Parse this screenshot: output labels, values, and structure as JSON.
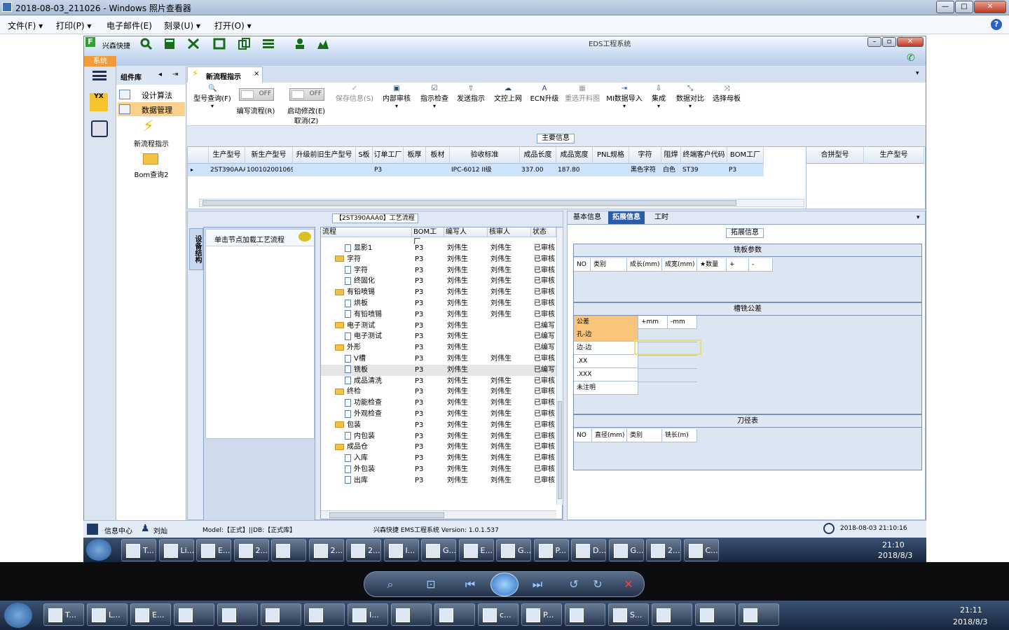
{
  "viewer": {
    "title": "2018-08-03_211026 - Windows 照片查看器",
    "menu": [
      "文件(F)",
      "打印(P)",
      "电子邮件(E)",
      "刻录(U)",
      "打开(O)"
    ]
  },
  "app": {
    "brand": "兴森快捷",
    "system_title": "EDS工程系统",
    "sys_tab": "系统",
    "component_lib": "组件库",
    "components": [
      "设计算法",
      "数据管理",
      "新流程指示",
      "Bom查询2"
    ],
    "doc_tab": "新流程指示",
    "toolbar": {
      "query": "型号查询(F)",
      "toggle1_state": "OFF",
      "toggle1": "编写流程(R)",
      "toggle2_state": "OFF",
      "toggle2": "启动修改(E)",
      "cancel": "取消(Z)",
      "save": "保存信息(S)",
      "internal_review": "内部审核",
      "instruct_check": "指示检查",
      "publish": "发送指示",
      "upload": "文控上网",
      "ecn": "ECN升级",
      "reselect": "重选开料图",
      "mi_import": "MI数据导入",
      "integrate": "集成",
      "compare": "数据对比",
      "choose_master": "选择母板"
    },
    "main_info_title": "主要信息",
    "grid": {
      "headers": [
        "生产型号",
        "新生产型号",
        "升级前旧生产型号",
        "S板",
        "订单工厂",
        "板厚",
        "板材",
        "验收标准",
        "成品长度",
        "成品宽度",
        "PNL规格",
        "字符",
        "阻焊",
        "终端客户代码",
        "BOM工厂"
      ],
      "row": [
        "2ST390AAA0",
        "10010200106928",
        "",
        "",
        "P3",
        "",
        "",
        "IPC-6012 II级",
        "337.00",
        "187.80",
        "",
        "黑色字符",
        "白色",
        "ST39",
        "P3"
      ],
      "side_headers": [
        "合拼型号",
        "生产型号"
      ]
    },
    "process_title": "【2ST390AAA0】工艺流程",
    "vtab": "设备结构",
    "node_hint": "单击节点加载工艺流程",
    "tree_headers": [
      "流程",
      "BOM工厂",
      "编写人",
      "核审人",
      "状态"
    ],
    "tree_rows": [
      {
        "name": "显影1",
        "level": 2,
        "type": "doc",
        "bom": "P3",
        "writer": "刘伟生",
        "reviewer": "刘伟生",
        "status": "已审核"
      },
      {
        "name": "字符",
        "level": 1,
        "type": "folder",
        "bom": "P3",
        "writer": "刘伟生",
        "reviewer": "刘伟生",
        "status": "已审核"
      },
      {
        "name": "字符",
        "level": 2,
        "type": "doc",
        "bom": "P3",
        "writer": "刘伟生",
        "reviewer": "刘伟生",
        "status": "已审核"
      },
      {
        "name": "终固化",
        "level": 2,
        "type": "doc",
        "bom": "P3",
        "writer": "刘伟生",
        "reviewer": "刘伟生",
        "status": "已审核"
      },
      {
        "name": "有铅喷锡",
        "level": 1,
        "type": "folder",
        "bom": "P3",
        "writer": "刘伟生",
        "reviewer": "刘伟生",
        "status": "已审核"
      },
      {
        "name": "烘板",
        "level": 2,
        "type": "doc",
        "bom": "P3",
        "writer": "刘伟生",
        "reviewer": "刘伟生",
        "status": "已审核"
      },
      {
        "name": "有铅喷锡",
        "level": 2,
        "type": "doc",
        "bom": "P3",
        "writer": "刘伟生",
        "reviewer": "刘伟生",
        "status": "已审核"
      },
      {
        "name": "电子测试",
        "level": 1,
        "type": "folder",
        "bom": "P3",
        "writer": "刘伟生",
        "reviewer": "",
        "status": "已编写"
      },
      {
        "name": "电子测试",
        "level": 2,
        "type": "doc",
        "bom": "P3",
        "writer": "刘伟生",
        "reviewer": "",
        "status": "已编写"
      },
      {
        "name": "外形",
        "level": 1,
        "type": "folder",
        "bom": "P3",
        "writer": "刘伟生",
        "reviewer": "",
        "status": "已编写"
      },
      {
        "name": "V槽",
        "level": 2,
        "type": "doc",
        "bom": "P3",
        "writer": "刘伟生",
        "reviewer": "刘伟生",
        "status": "已审核"
      },
      {
        "name": "铣板",
        "level": 2,
        "type": "doc",
        "bom": "P3",
        "writer": "刘伟生",
        "reviewer": "",
        "status": "已编写"
      },
      {
        "name": "成品清洗",
        "level": 2,
        "type": "doc",
        "bom": "P3",
        "writer": "刘伟生",
        "reviewer": "刘伟生",
        "status": "已审核"
      },
      {
        "name": "终检",
        "level": 1,
        "type": "folder",
        "bom": "P3",
        "writer": "刘伟生",
        "reviewer": "刘伟生",
        "status": "已审核"
      },
      {
        "name": "功能检查",
        "level": 2,
        "type": "doc",
        "bom": "P3",
        "writer": "刘伟生",
        "reviewer": "刘伟生",
        "status": "已审核"
      },
      {
        "name": "外观检查",
        "level": 2,
        "type": "doc",
        "bom": "P3",
        "writer": "刘伟生",
        "reviewer": "刘伟生",
        "status": "已审核"
      },
      {
        "name": "包装",
        "level": 1,
        "type": "folder",
        "bom": "P3",
        "writer": "刘伟生",
        "reviewer": "刘伟生",
        "status": "已审核"
      },
      {
        "name": "内包装",
        "level": 2,
        "type": "doc",
        "bom": "P3",
        "writer": "刘伟生",
        "reviewer": "刘伟生",
        "status": "已审核"
      },
      {
        "name": "成品仓",
        "level": 1,
        "type": "folder",
        "bom": "P3",
        "writer": "刘伟生",
        "reviewer": "刘伟生",
        "status": "已审核"
      },
      {
        "name": "入库",
        "level": 2,
        "type": "doc",
        "bom": "P3",
        "writer": "刘伟生",
        "reviewer": "刘伟生",
        "status": "已审核"
      },
      {
        "name": "外包装",
        "level": 2,
        "type": "doc",
        "bom": "P3",
        "writer": "刘伟生",
        "reviewer": "刘伟生",
        "status": "已审核"
      },
      {
        "name": "出库",
        "level": 2,
        "type": "doc",
        "bom": "P3",
        "writer": "刘伟生",
        "reviewer": "刘伟生",
        "status": "已审核"
      }
    ],
    "right_tabs": [
      "基本信息",
      "拓展信息",
      "工时"
    ],
    "ext_title": "拓展信息",
    "mill_params": {
      "title": "铣板参数",
      "headers": [
        "NO",
        "类别",
        "成长(mm)",
        "成宽(mm)",
        "★数量",
        "+",
        "-"
      ]
    },
    "groove_tol": {
      "title": "槽铣公差",
      "headers": [
        "公差",
        "+mm",
        "-mm"
      ],
      "rows": [
        "孔-边",
        "边-边",
        ".XX",
        ".XXX",
        "未注明"
      ]
    },
    "tool_table": {
      "title": "刀径表",
      "headers": [
        "NO",
        "直径(mm)",
        "类别",
        "铣长(m)"
      ]
    },
    "status": {
      "info_center": "信息中心",
      "user": "刘灿",
      "model": "Model:【正式】||DB:【正式库】",
      "version": "兴森快捷 EMS工程系统 Version: 1.0.1.537",
      "datetime": "2018-08-03 21:10:16"
    }
  },
  "taskbar1": {
    "buttons": [
      "T...",
      "Li...",
      "E...",
      "2...",
      "",
      "2...",
      "2...",
      "I...",
      "G...",
      "E...",
      "G...",
      "P...",
      "D...",
      "G...",
      "2...",
      "C..."
    ],
    "time": "21:10",
    "date": "2018/8/3"
  },
  "taskbar2": {
    "buttons": [
      "T...",
      "L...",
      "E...",
      "",
      "",
      "",
      "",
      "I...",
      "",
      "",
      "c...",
      "P...",
      "",
      "S...",
      "",
      "",
      ""
    ],
    "time": "21:11",
    "date": "2018/8/3"
  }
}
